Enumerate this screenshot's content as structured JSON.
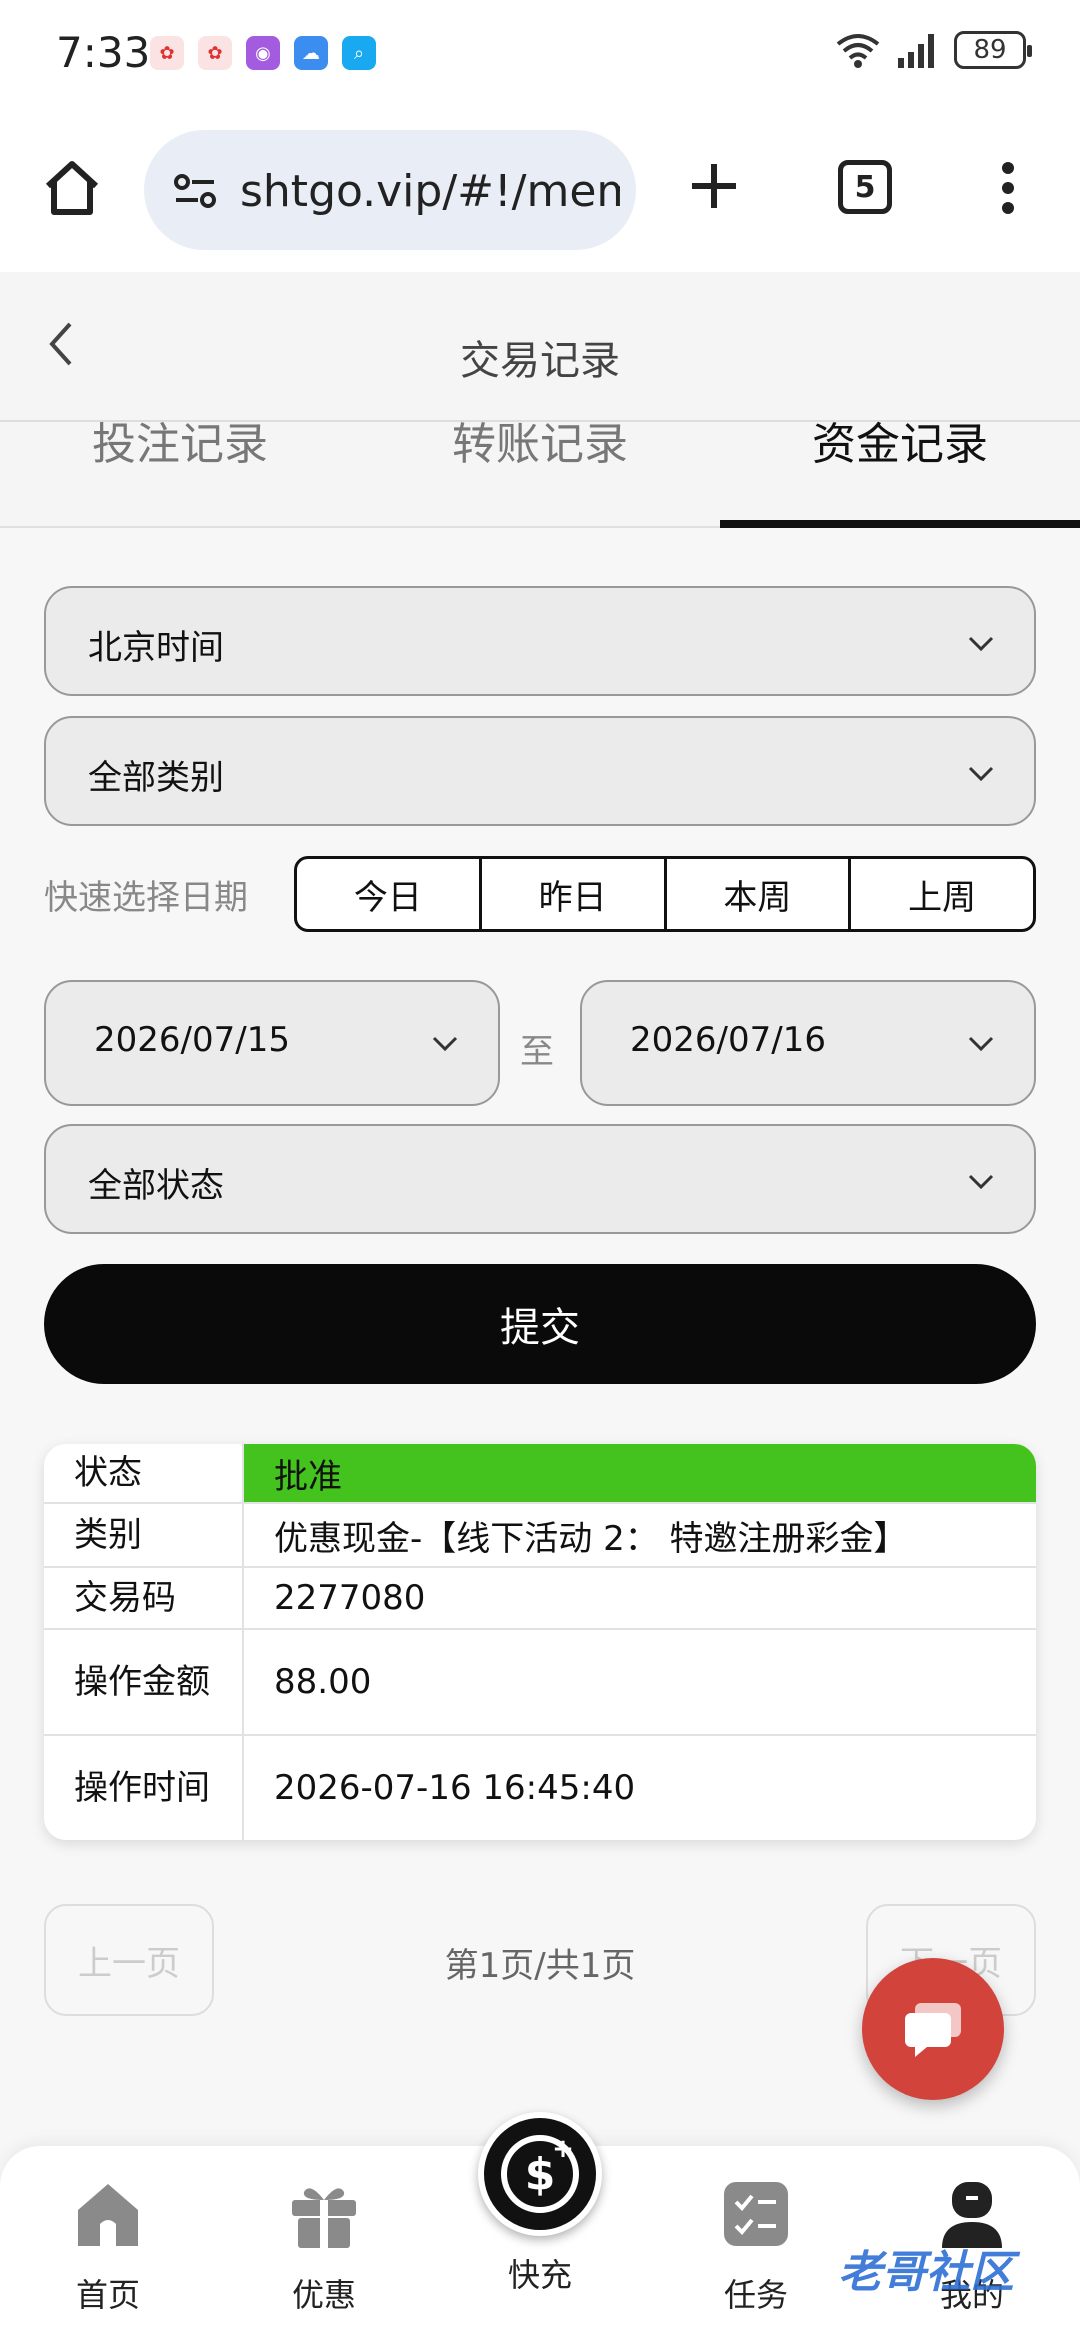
{
  "status_bar": {
    "time": "7:33",
    "battery": "89"
  },
  "browser": {
    "url": "shtgo.vip/#!/mem",
    "tab_count": "5"
  },
  "header": {
    "title": "交易记录"
  },
  "tabs": [
    {
      "label": "投注记录",
      "active": false
    },
    {
      "label": "转账记录",
      "active": false
    },
    {
      "label": "资金记录",
      "active": true
    }
  ],
  "filters": {
    "timezone": "北京时间",
    "category": "全部类别",
    "quick_date_label": "快速选择日期",
    "quick_dates": [
      "今日",
      "昨日",
      "本周",
      "上周"
    ],
    "date_from": "2026/07/15",
    "date_separator": "至",
    "date_to": "2026/07/16",
    "status": "全部状态",
    "submit_label": "提交"
  },
  "record": {
    "rows": [
      {
        "label": "状态",
        "value": "批准"
      },
      {
        "label": "类别",
        "value": "优惠现金-【线下活动 2： 特邀注册彩金】"
      },
      {
        "label": "交易码",
        "value": "2277080"
      },
      {
        "label": "操作金额",
        "value": "88.00"
      },
      {
        "label": "操作时间",
        "value": "2026-07-16 16:45:40"
      }
    ],
    "status_color": "#44c21d"
  },
  "pagination": {
    "prev_label": "上一页",
    "info": "第1页/共1页",
    "next_label": "下一页"
  },
  "bottom_nav": {
    "items": [
      "首页",
      "优惠",
      "快充",
      "任务",
      "我的"
    ]
  },
  "watermark": "老哥社区",
  "colors": {
    "accent": "#0a0a0a",
    "fab": "#d2433c"
  }
}
